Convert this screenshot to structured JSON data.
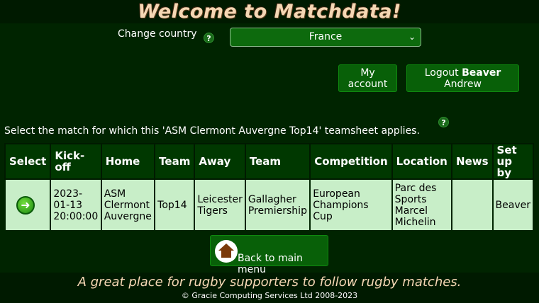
{
  "header": {
    "title": "Welcome to Matchdata!"
  },
  "country": {
    "label": "Change country",
    "help": "?",
    "selected": "France"
  },
  "account": {
    "my_account_line1": "My",
    "my_account_line2": "account",
    "logout_prefix": "Logout ",
    "user_surname": "Beaver",
    "user_firstname": "Andrew"
  },
  "instructions": {
    "text": "Select the match for which this 'ASM Clermont Auvergne Top14' teamsheet applies.",
    "help": "?"
  },
  "table": {
    "headers": [
      "Select",
      "Kick-off",
      "Home",
      "Team",
      "Away",
      "Team",
      "Competition",
      "Location",
      "News",
      "Set up by"
    ],
    "rows": [
      {
        "select_icon": "arrow-right-icon",
        "kickoff": "2023-01-13 20:00:00",
        "home": "ASM Clermont Auvergne",
        "home_team": "Top14",
        "away": "Leicester Tigers",
        "away_team": "Gallagher Premiership",
        "competition": "European Champions Cup",
        "location": "Parc des Sports Marcel Michelin",
        "news": "",
        "setup_by": "Beaver"
      }
    ]
  },
  "back": {
    "label": "Back to main menu",
    "icon": "home-icon"
  },
  "footer": {
    "tagline": "A great place for rugby supporters to follow rugby matches.",
    "copyright": "© Gracie Computing Services Ltd 2008-2023"
  },
  "colors": {
    "background": "#002400",
    "accent_green": "#086008",
    "row_bg": "#c8eec8",
    "title_color": "#f5d7b4"
  }
}
